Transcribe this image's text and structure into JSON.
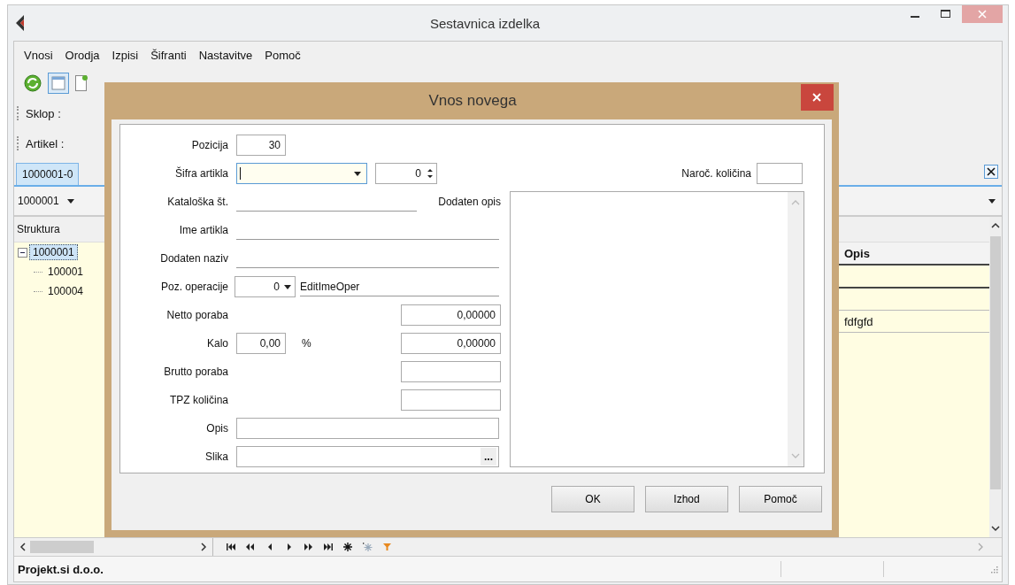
{
  "window": {
    "title": "Sestavnica izdelka"
  },
  "menu": [
    {
      "label": "Vnosi"
    },
    {
      "label": "Orodja"
    },
    {
      "label": "Izpisi"
    },
    {
      "label": "Šifranti"
    },
    {
      "label": "Nastavitve"
    },
    {
      "label": "Pomoč"
    }
  ],
  "filters": [
    {
      "label": "Sklop :"
    },
    {
      "label": "Artikel :"
    }
  ],
  "tabs": [
    {
      "label": "1000001-0",
      "selected": true
    }
  ],
  "selector": {
    "value": "1000001"
  },
  "tree": {
    "header": "Struktura",
    "items": [
      {
        "label": "1000001",
        "selected": true,
        "expanded": true,
        "children": [
          {
            "label": "100001",
            "selected": false
          },
          {
            "label": "100004",
            "selected": false
          }
        ]
      }
    ]
  },
  "grid": {
    "columns": [
      {
        "label": "Opis"
      }
    ],
    "rows": [
      {
        "cells": [
          "fdfgfd"
        ]
      }
    ]
  },
  "status_bar": {
    "text": "Projekt.si d.o.o."
  },
  "dialog": {
    "title": "Vnos novega",
    "fields": [
      {
        "kind": "number",
        "label": "Pozicija",
        "value": "30"
      },
      {
        "kind": "combo-spin",
        "label": "Šifra artikla",
        "spin": "0",
        "focused": true
      },
      {
        "kind": "line-caption",
        "label": "Kataloška št.",
        "caption": "Dodaten opis"
      },
      {
        "kind": "line",
        "label": "Ime artikla"
      },
      {
        "kind": "line",
        "label": "Dodaten naziv"
      },
      {
        "kind": "op",
        "label": "Poz. operacije",
        "value": "0",
        "text": "EditImeOper"
      },
      {
        "kind": "amount",
        "label": "Netto poraba",
        "value": "0,00000"
      },
      {
        "kind": "percent",
        "label": "Kalo",
        "value": "0,00",
        "unit": "%",
        "amount": "0,00000"
      },
      {
        "kind": "amount",
        "label": "Brutto poraba"
      },
      {
        "kind": "amount",
        "label": "TPZ količina"
      },
      {
        "kind": "box",
        "label": "Opis"
      },
      {
        "kind": "browse",
        "label": "Slika",
        "button": "..."
      }
    ],
    "side_field": {
      "label": "Naroč. količina"
    },
    "buttons": [
      {
        "label": "OK"
      },
      {
        "label": "Izhod"
      },
      {
        "label": "Pomoč"
      }
    ]
  }
}
